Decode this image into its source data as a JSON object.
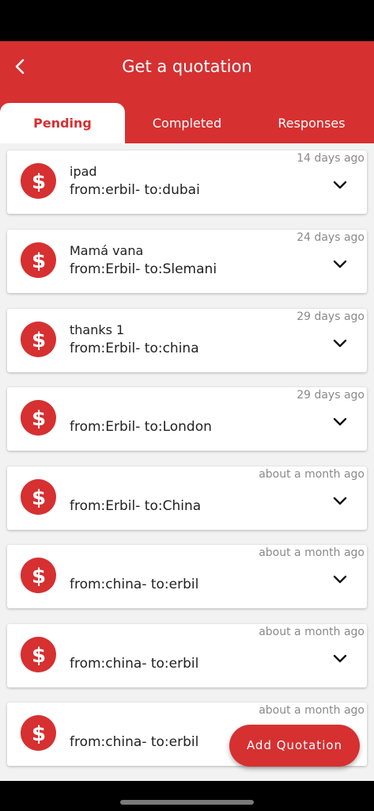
{
  "header": {
    "title": "Get a quotation"
  },
  "tabs": [
    {
      "label": "Pending",
      "active": true
    },
    {
      "label": "Completed",
      "active": false
    },
    {
      "label": "Responses",
      "active": false
    }
  ],
  "quotations": [
    {
      "title": "ipad",
      "route": "from:erbil- to:dubai",
      "time": "14 days ago"
    },
    {
      "title": "Mamá vana",
      "route": "from:Erbil- to:Slemani",
      "time": "24 days ago"
    },
    {
      "title": "thanks 1",
      "route": "from:Erbil- to:china",
      "time": "29 days ago"
    },
    {
      "title": "",
      "route": "from:Erbil- to:London",
      "time": "29 days ago"
    },
    {
      "title": "",
      "route": "from:Erbil- to:China",
      "time": "about a month ago"
    },
    {
      "title": "",
      "route": "from:china- to:erbil",
      "time": "about a month ago"
    },
    {
      "title": "",
      "route": "from:china- to:erbil",
      "time": "about a month ago"
    },
    {
      "title": "",
      "route": "from:china- to:erbil",
      "time": "about a month ago"
    }
  ],
  "fab": {
    "label": "Add Quotation"
  },
  "icons": {
    "back": "chevron-left-icon",
    "quotation": "dollar-icon",
    "expand": "chevron-down-icon"
  },
  "colors": {
    "primary": "#d63031",
    "background": "#f2f2f2",
    "card": "#ffffff",
    "muted_text": "#8a8a8a"
  }
}
